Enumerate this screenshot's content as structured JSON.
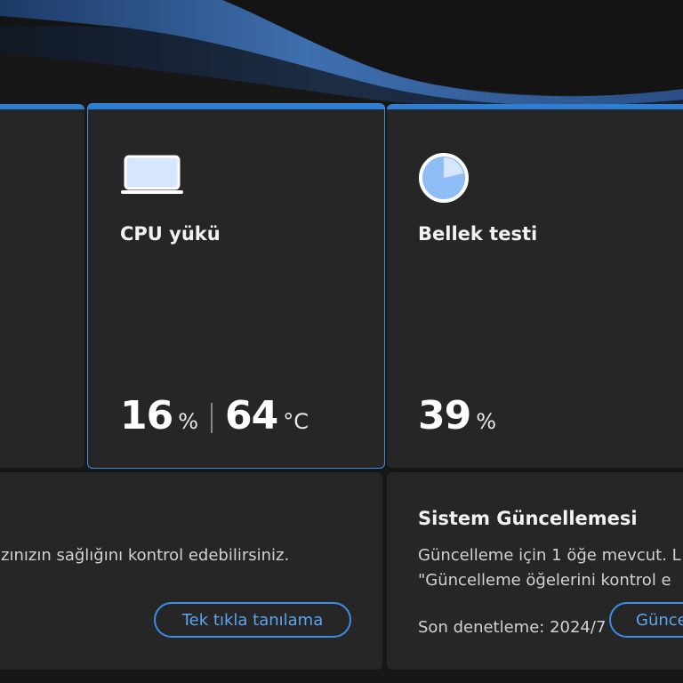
{
  "colors": {
    "background": "#171717",
    "card": "#262626",
    "accent": "#2d7fd6",
    "button_text": "#5aa6f2",
    "icon_fill": "#d6e6ff"
  },
  "cpu_card": {
    "icon": "laptop-icon",
    "title": "CPU yükü",
    "load_value": "16",
    "load_unit": "%",
    "temp_value": "64",
    "temp_unit": "°C"
  },
  "memory_card": {
    "icon": "memory-pie-icon",
    "title": "Bellek testi",
    "value": "39",
    "unit": "%"
  },
  "diagnostics_card": {
    "description": "azınızın sağlığını kontrol edebilirsiniz.",
    "button_label": "Tek tıkla tanılama"
  },
  "update_card": {
    "title": "Sistem Güncellemesi",
    "line1": "Güncelleme için 1 öğe mevcut. L",
    "line2": "\"Güncelleme öğelerini kontrol e",
    "last_checked": "Son denetleme: 2024/7",
    "button_label": "Günce"
  }
}
